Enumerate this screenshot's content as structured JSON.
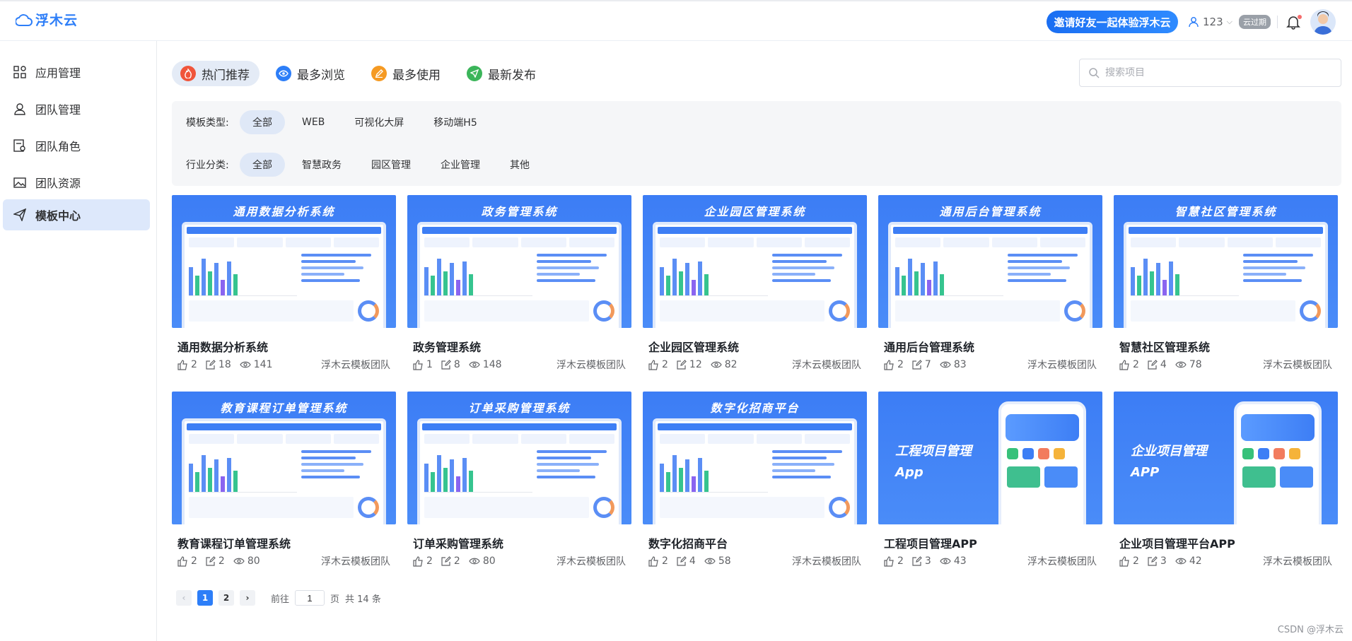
{
  "header": {
    "logo_text": "浮木云",
    "invite_label": "邀请好友一起体验浮木云",
    "user_count": "123",
    "expired_badge": "云过期"
  },
  "sidebar": {
    "items": [
      {
        "label": "应用管理",
        "icon": "apps-grid-icon"
      },
      {
        "label": "团队管理",
        "icon": "team-user-icon"
      },
      {
        "label": "团队角色",
        "icon": "role-icon"
      },
      {
        "label": "团队资源",
        "icon": "resource-image-icon"
      },
      {
        "label": "模板中心",
        "icon": "paper-plane-icon",
        "active": true
      }
    ]
  },
  "sort_tabs": [
    {
      "label": "热门推荐",
      "color": "#f0553b",
      "active": true
    },
    {
      "label": "最多浏览",
      "color": "#2d7ef8"
    },
    {
      "label": "最多使用",
      "color": "#f59a23"
    },
    {
      "label": "最新发布",
      "color": "#3bb55a"
    }
  ],
  "search": {
    "placeholder": "搜索项目"
  },
  "filters": {
    "type_label": "模板类型:",
    "type_options": [
      "全部",
      "WEB",
      "可视化大屏",
      "移动端H5"
    ],
    "industry_label": "行业分类:",
    "industry_options": [
      "全部",
      "智慧政务",
      "园区管理",
      "企业管理",
      "其他"
    ]
  },
  "cards": [
    {
      "banner": "通用数据分析系统",
      "title": "通用数据分析系统",
      "likes": "2",
      "uses": "18",
      "views": "141",
      "team": "浮木云模板团队"
    },
    {
      "banner": "政务管理系统",
      "title": "政务管理系统",
      "likes": "1",
      "uses": "8",
      "views": "148",
      "team": "浮木云模板团队"
    },
    {
      "banner": "企业园区管理系统",
      "title": "企业园区管理系统",
      "likes": "2",
      "uses": "12",
      "views": "82",
      "team": "浮木云模板团队"
    },
    {
      "banner": "通用后台管理系统",
      "title": "通用后台管理系统",
      "likes": "2",
      "uses": "7",
      "views": "83",
      "team": "浮木云模板团队"
    },
    {
      "banner": "智慧社区管理系统",
      "title": "智慧社区管理系统",
      "likes": "2",
      "uses": "4",
      "views": "78",
      "team": "浮木云模板团队"
    },
    {
      "banner": "教育课程订单管理系统",
      "title": "教育课程订单管理系统",
      "likes": "2",
      "uses": "2",
      "views": "80",
      "team": "浮木云模板团队"
    },
    {
      "banner": "订单采购管理系统",
      "title": "订单采购管理系统",
      "likes": "2",
      "uses": "2",
      "views": "80",
      "team": "浮木云模板团队"
    },
    {
      "banner": "数字化招商平台",
      "title": "数字化招商平台",
      "likes": "2",
      "uses": "4",
      "views": "58",
      "team": "浮木云模板团队"
    },
    {
      "banner": "工程项目管理App",
      "title": "工程项目管理APP",
      "likes": "2",
      "uses": "3",
      "views": "43",
      "team": "浮木云模板团队",
      "app": true
    },
    {
      "banner": "企业项目管理APP",
      "title": "企业项目管理平台APP",
      "likes": "2",
      "uses": "3",
      "views": "42",
      "team": "浮木云模板团队",
      "app": true
    }
  ],
  "pagination": {
    "pages": [
      "1",
      "2"
    ],
    "current": "1",
    "goto_prefix": "前往",
    "goto_value": "1",
    "goto_suffix": "页",
    "total": "共 14 条"
  },
  "watermark": "CSDN @浮木云"
}
